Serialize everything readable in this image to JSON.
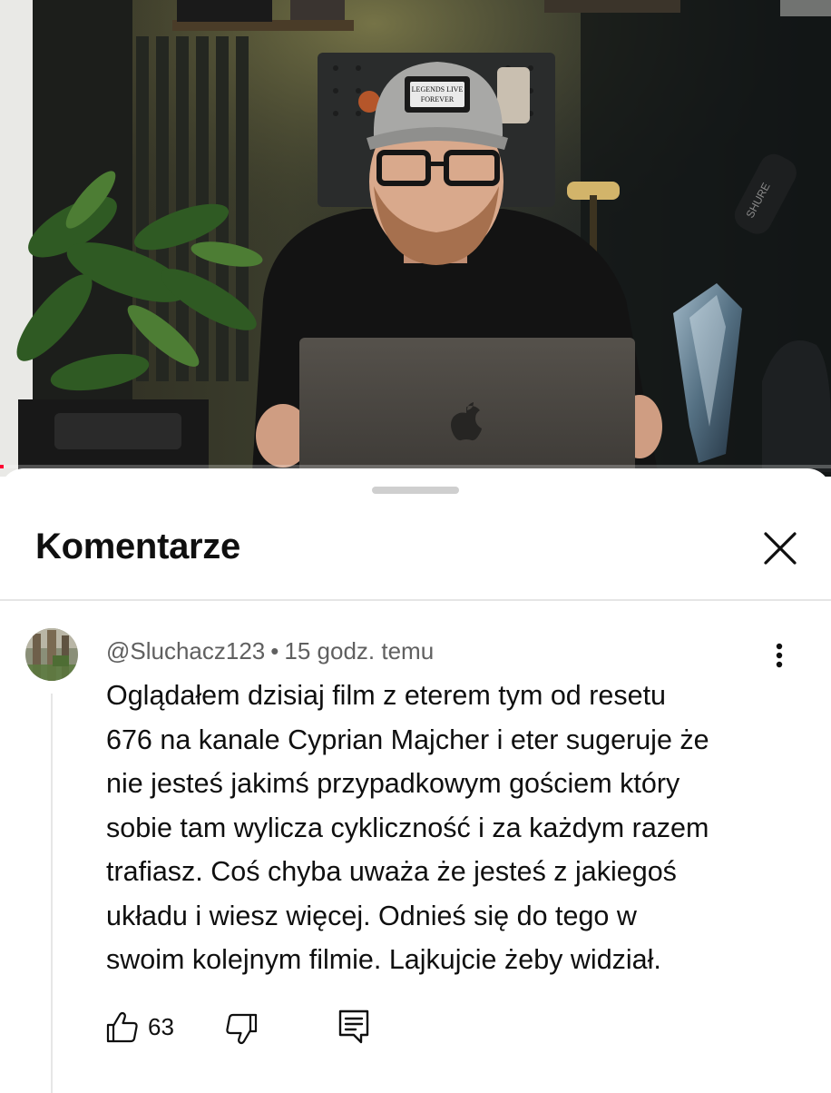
{
  "video": {
    "cap_text_line1": "LEGENDS LIVE",
    "cap_text_line2": "FOREVER",
    "mic_brand": "SHURE",
    "progress_fraction": 0.004
  },
  "comments_panel": {
    "title": "Komentarze",
    "close_icon": "close-icon"
  },
  "comment": {
    "author": "@Sluchacz123",
    "separator": "•",
    "time": "15 godz. temu",
    "text_lines": [
      "Oglądałem dzisiaj film z eterem tym od resetu",
      "676 na kanale Cyprian Majcher i eter sugeruje że",
      "nie jesteś jakimś przypadkowym gościem który",
      "sobie tam wylicza cykliczność i za każdym razem",
      "trafiasz. Coś chyba uważa że jesteś z jakiegoś",
      "układu i wiesz więcej. Odnieś się do tego w",
      "swoim kolejnym filmie. Lajkujcie żeby widział."
    ],
    "likes": "63",
    "icons": {
      "like": "thumbs-up-icon",
      "dislike": "thumbs-down-icon",
      "reply": "reply-comment-icon",
      "more": "more-vertical-icon"
    }
  }
}
